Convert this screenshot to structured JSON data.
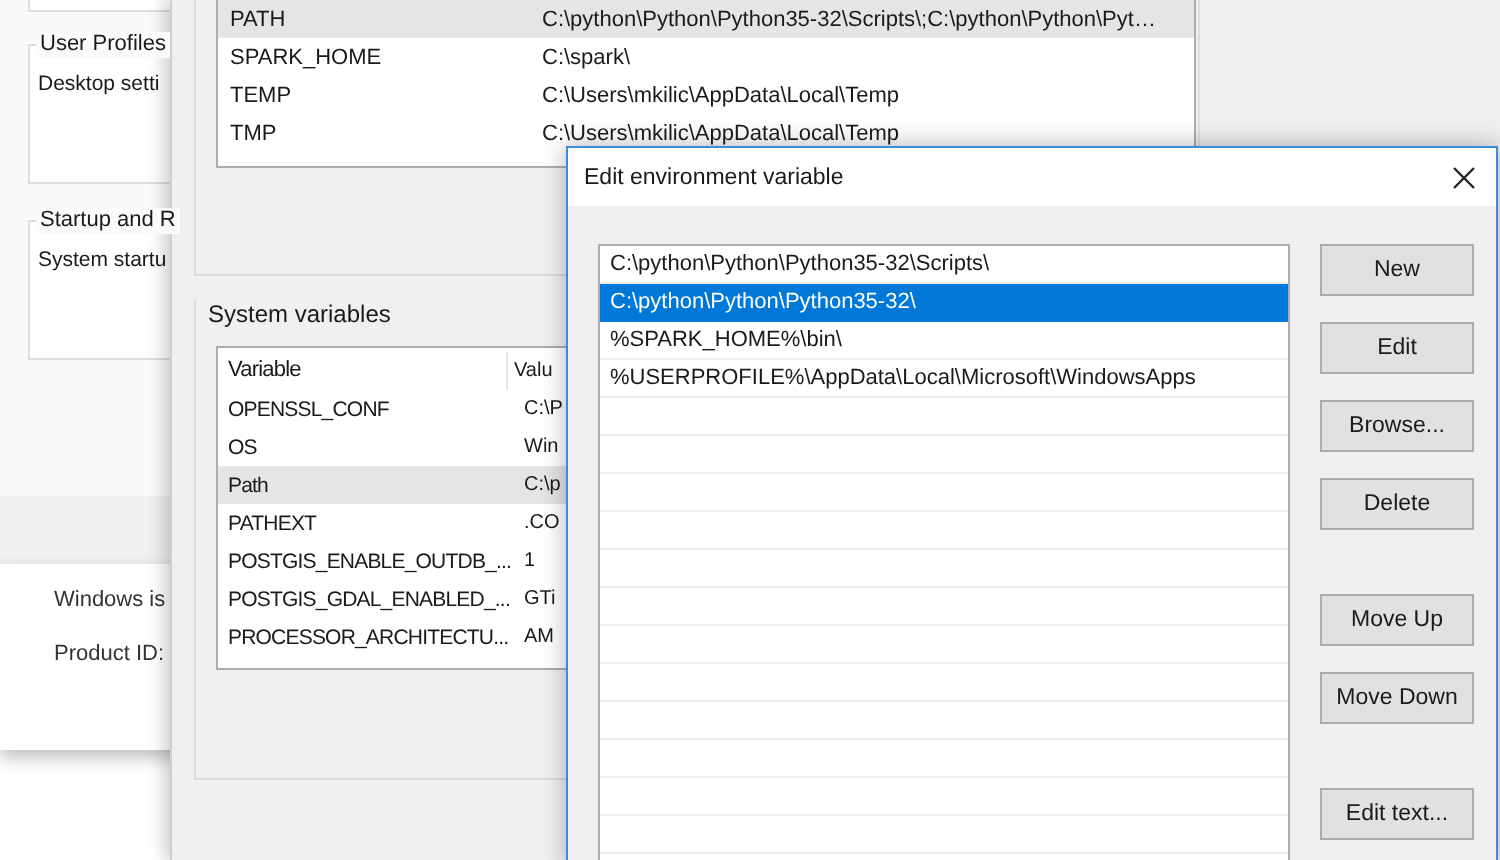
{
  "system_properties": {
    "groups": [
      {
        "title": "User Profiles",
        "text": "Desktop setti"
      },
      {
        "title": "Startup and R",
        "text": "System startu"
      }
    ]
  },
  "system_window": {
    "lines": [
      "Windows is",
      "Product ID:"
    ]
  },
  "environment_variables": {
    "user_variables": {
      "rows": [
        {
          "variable": "PATH",
          "value": "C:\\python\\Python\\Python35-32\\Scripts\\;C:\\python\\Python\\Pyt…",
          "selected": true
        },
        {
          "variable": "SPARK_HOME",
          "value": "C:\\spark\\",
          "selected": false
        },
        {
          "variable": "TEMP",
          "value": "C:\\Users\\mkilic\\AppData\\Local\\Temp",
          "selected": false
        },
        {
          "variable": "TMP",
          "value": "C:\\Users\\mkilic\\AppData\\Local\\Temp",
          "selected": false
        }
      ]
    },
    "system_variables": {
      "label": "System variables",
      "columns": [
        "Variable",
        "Valu"
      ],
      "rows": [
        {
          "variable": "OPENSSL_CONF",
          "value": "C:\\P",
          "selected": false
        },
        {
          "variable": "OS",
          "value": "Win",
          "selected": false
        },
        {
          "variable": "Path",
          "value": "C:\\p",
          "selected": true
        },
        {
          "variable": "PATHEXT",
          "value": ".CO",
          "selected": false
        },
        {
          "variable": "POSTGIS_ENABLE_OUTDB_...",
          "value": "1",
          "selected": false
        },
        {
          "variable": "POSTGIS_GDAL_ENABLED_...",
          "value": "GTi",
          "selected": false
        },
        {
          "variable": "PROCESSOR_ARCHITECTU...",
          "value": "AM",
          "selected": false
        }
      ]
    }
  },
  "edit_dialog": {
    "title": "Edit environment variable",
    "entries": [
      {
        "text": "C:\\python\\Python\\Python35-32\\Scripts\\",
        "selected": false
      },
      {
        "text": "C:\\python\\Python\\Python35-32\\",
        "selected": true
      },
      {
        "text": "%SPARK_HOME%\\bin\\",
        "selected": false
      },
      {
        "text": "%USERPROFILE%\\AppData\\Local\\Microsoft\\WindowsApps",
        "selected": false
      }
    ],
    "button_groups": [
      [
        "New",
        "Edit",
        "Browse...",
        "Delete"
      ],
      [
        "Move Up",
        "Move Down"
      ],
      [
        "Edit text..."
      ]
    ]
  }
}
